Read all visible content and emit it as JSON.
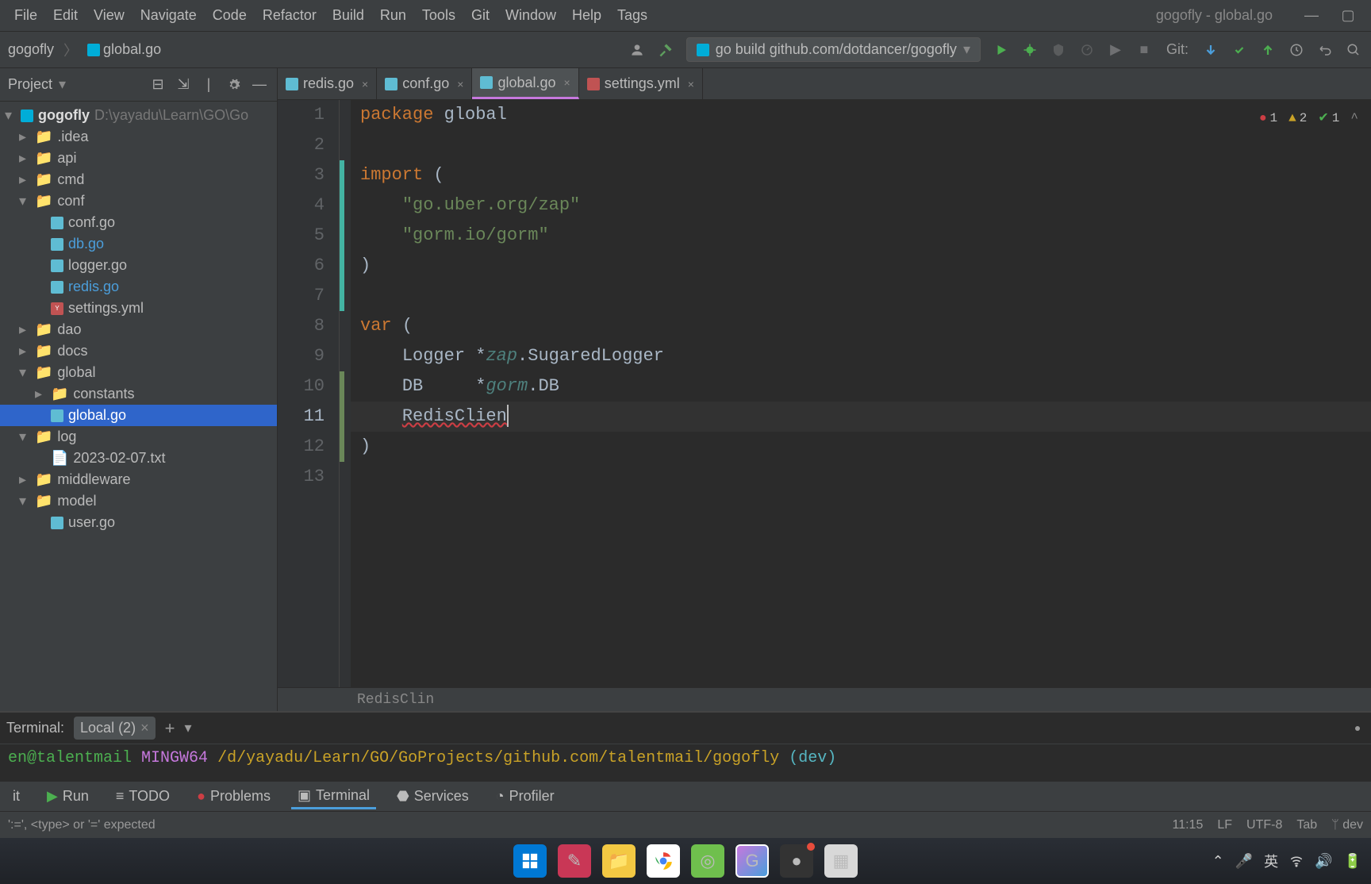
{
  "window": {
    "title": "gogofly - global.go"
  },
  "menu": [
    "File",
    "Edit",
    "View",
    "Navigate",
    "Code",
    "Refactor",
    "Build",
    "Run",
    "Tools",
    "Git",
    "Window",
    "Help",
    "Tags"
  ],
  "breadcrumb": [
    "gogofly",
    "global.go"
  ],
  "run_config": "go build github.com/dotdancer/gogofly",
  "git_label": "Git:",
  "project_panel": {
    "title": "Project"
  },
  "tree_root": {
    "name": "gogofly",
    "path": "D:\\yayadu\\Learn\\GO\\Go"
  },
  "tree": [
    {
      "label": ".idea",
      "type": "folder",
      "indent": 1
    },
    {
      "label": "api",
      "type": "folder",
      "indent": 1
    },
    {
      "label": "cmd",
      "type": "folder",
      "indent": 1
    },
    {
      "label": "conf",
      "type": "folder",
      "indent": 1,
      "expanded": true
    },
    {
      "label": "conf.go",
      "type": "go",
      "indent": 2
    },
    {
      "label": "db.go",
      "type": "go",
      "indent": 2,
      "highlight": true
    },
    {
      "label": "logger.go",
      "type": "go",
      "indent": 2
    },
    {
      "label": "redis.go",
      "type": "go",
      "indent": 2,
      "highlight": true
    },
    {
      "label": "settings.yml",
      "type": "yml",
      "indent": 2
    },
    {
      "label": "dao",
      "type": "folder",
      "indent": 1
    },
    {
      "label": "docs",
      "type": "folder",
      "indent": 1
    },
    {
      "label": "global",
      "type": "folder",
      "indent": 1,
      "expanded": true
    },
    {
      "label": "constants",
      "type": "folder",
      "indent": 2
    },
    {
      "label": "global.go",
      "type": "go",
      "indent": 2,
      "selected": true
    },
    {
      "label": "log",
      "type": "folder",
      "indent": 1,
      "expanded": true
    },
    {
      "label": "2023-02-07.txt",
      "type": "txt",
      "indent": 2
    },
    {
      "label": "middleware",
      "type": "folder",
      "indent": 1
    },
    {
      "label": "model",
      "type": "folder",
      "indent": 1,
      "expanded": true
    },
    {
      "label": "user.go",
      "type": "go",
      "indent": 2
    }
  ],
  "tabs": [
    {
      "label": "redis.go",
      "type": "go"
    },
    {
      "label": "conf.go",
      "type": "go"
    },
    {
      "label": "global.go",
      "type": "go",
      "active": true
    },
    {
      "label": "settings.yml",
      "type": "yml"
    }
  ],
  "code": {
    "l1_kw": "package",
    "l1_pkg": "global",
    "l3_kw": "import",
    "l3_p": "(",
    "l4": "\"go.uber.org/zap\"",
    "l5": "\"gorm.io/gorm\"",
    "l6": ")",
    "l8_kw": "var",
    "l8_p": "(",
    "l9_a": "Logger",
    "l9_b": "*",
    "l9_c": "zap",
    "l9_d": ".SugaredLogger",
    "l10_a": "DB",
    "l10_b": "*",
    "l10_c": "gorm",
    "l10_d": ".DB",
    "l11_a": "RedisClien",
    "l12": ")"
  },
  "line_count": 13,
  "current_line": 11,
  "inspections": {
    "errors": "1",
    "warnings": "2",
    "weak": "1"
  },
  "breadcrumb_code": "RedisClin",
  "terminal": {
    "label": "Terminal:",
    "tab": "Local (2)",
    "user": "en@talentmail",
    "env": "MINGW64",
    "path": "/d/yayadu/Learn/GO/GoProjects/github.com/talentmail/gogofly",
    "branch": "(dev)"
  },
  "toolwindows": [
    "Run",
    "TODO",
    "Problems",
    "Terminal",
    "Services",
    "Profiler"
  ],
  "toolwindows_first": "it",
  "status": {
    "msg": "':=', <type> or '=' expected",
    "pos": "11:15",
    "le": "LF",
    "enc": "UTF-8",
    "indent": "Tab",
    "branch": "dev"
  }
}
